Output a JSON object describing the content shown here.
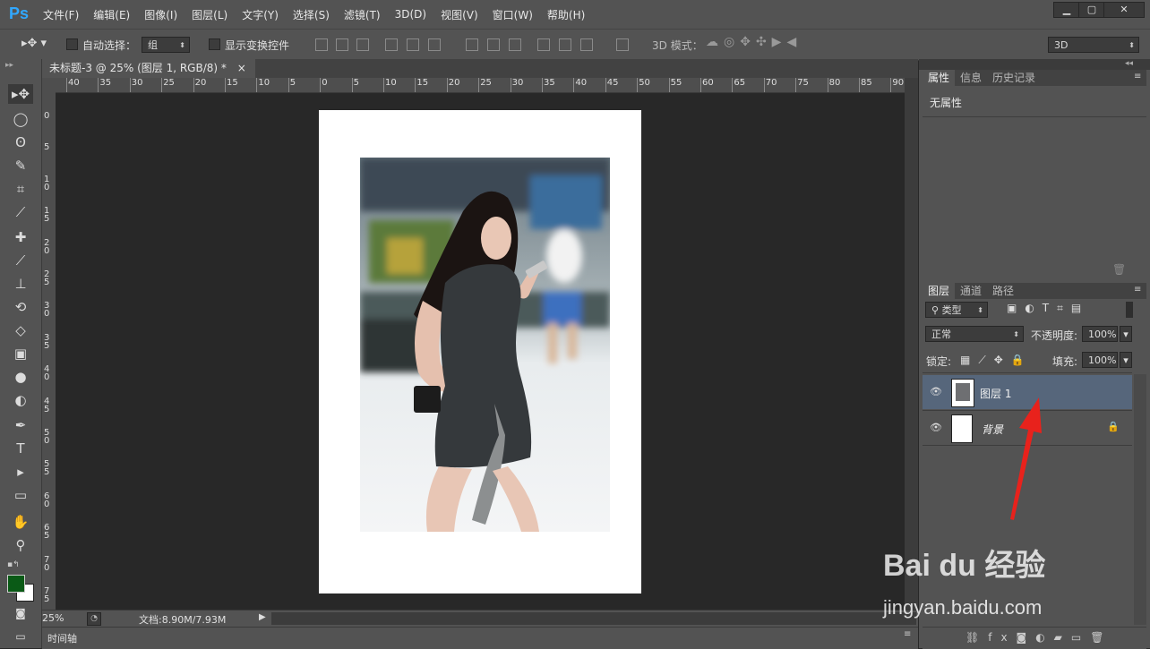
{
  "app": {
    "logo": "Ps"
  },
  "menu": [
    "文件(F)",
    "编辑(E)",
    "图像(I)",
    "图层(L)",
    "文字(Y)",
    "选择(S)",
    "滤镜(T)",
    "3D(D)",
    "视图(V)",
    "窗口(W)",
    "帮助(H)"
  ],
  "window_controls": {
    "minimize": "▁",
    "maximize": "▢",
    "close": "✕"
  },
  "options_bar": {
    "auto_select_label": "自动选择：",
    "auto_select_value": "组",
    "show_transform_label": "显示变换控件",
    "mode_3d_label": "3D 模式：",
    "workspace_value": "3D"
  },
  "document_tab": {
    "title": "未标题-3 @ 25% (图层 1, RGB/8) *",
    "close": "×"
  },
  "ruler": {
    "h_ticks": [
      "40",
      "35",
      "30",
      "25",
      "20",
      "15",
      "10",
      "5",
      "0",
      "5",
      "10",
      "15",
      "20",
      "25",
      "30",
      "35",
      "40",
      "45",
      "50",
      "55",
      "60",
      "65",
      "70",
      "75",
      "80",
      "85",
      "90"
    ],
    "v_ticks": [
      "0",
      "5",
      "10",
      "15",
      "20",
      "25",
      "30",
      "35",
      "40",
      "45",
      "50",
      "55",
      "60",
      "65",
      "70",
      "75"
    ]
  },
  "status": {
    "zoom": "25%",
    "doc_info": "文档:8.90M/7.93M"
  },
  "timeline_label": "时间轴",
  "properties_panel": {
    "tabs": [
      "属性",
      "信息",
      "历史记录"
    ],
    "content": "无属性"
  },
  "layers_panel": {
    "tabs": [
      "图层",
      "通道",
      "路径"
    ],
    "filter_kind": "类型",
    "blend_mode": "正常",
    "opacity_label": "不透明度:",
    "opacity_value": "100%",
    "lock_label": "锁定:",
    "fill_label": "填充:",
    "fill_value": "100%",
    "layers": [
      {
        "name": "图层 1",
        "selected": true
      },
      {
        "name": "背景",
        "selected": false,
        "locked": true
      }
    ]
  },
  "colors": {
    "foreground": "#0a5a16",
    "background": "#ffffff",
    "accent": "#31a8ff"
  },
  "watermark": {
    "brand": "Bai du 经验",
    "url": "jingyan.baidu.com"
  }
}
